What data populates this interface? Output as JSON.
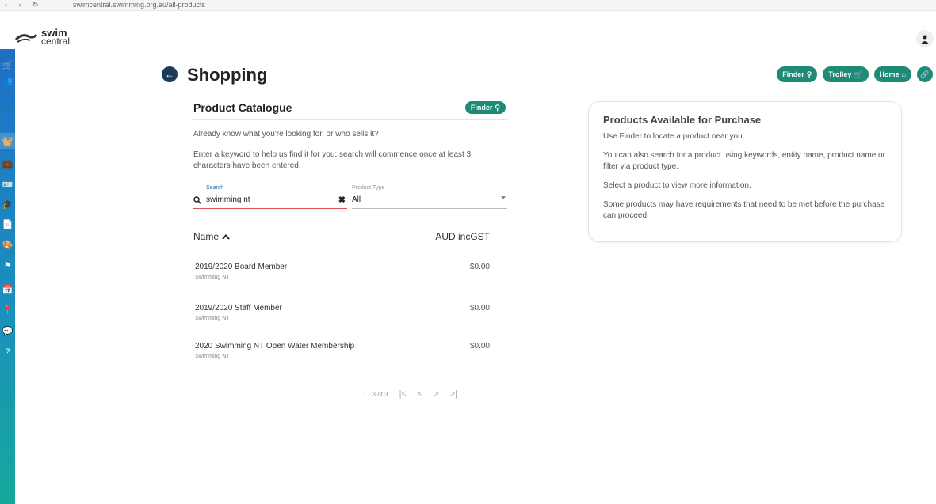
{
  "browser": {
    "nav_glyphs": "‹ › ↻",
    "url": "swimcentral.swimming.org.au/all-products"
  },
  "header": {
    "logo_line1": "swim",
    "logo_line2": "central",
    "profile_icon": "person-icon"
  },
  "sidebar": {
    "items": [
      {
        "icon": "cart-icon",
        "glyph": "🛒"
      },
      {
        "icon": "group-icon",
        "glyph": "👥"
      },
      {
        "icon": "add-person-icon",
        "glyph": "👤"
      },
      {
        "icon": "person-icon",
        "glyph": "👤"
      },
      {
        "icon": "basket-icon",
        "glyph": "🧺",
        "active": true
      },
      {
        "icon": "briefcase-icon",
        "glyph": "💼"
      },
      {
        "icon": "id-card-icon",
        "glyph": "🪪"
      },
      {
        "icon": "graduation-cap-icon",
        "glyph": "🎓"
      },
      {
        "icon": "document-icon",
        "glyph": "📄"
      },
      {
        "icon": "palette-icon",
        "glyph": "🎨"
      },
      {
        "icon": "flag-icon",
        "glyph": "⚑"
      },
      {
        "icon": "calendar-icon",
        "glyph": "📅"
      },
      {
        "icon": "map-pin-icon",
        "glyph": "📍"
      },
      {
        "icon": "chat-icon",
        "glyph": "💬"
      },
      {
        "icon": "help-icon",
        "glyph": "?"
      }
    ]
  },
  "page": {
    "back_glyph": "←",
    "title": "Shopping"
  },
  "actions": {
    "finder": "Finder",
    "trolley": "Trolley",
    "home": "Home",
    "finder_glyph": "⚲",
    "trolley_glyph": "🛒",
    "home_glyph": "⌂",
    "link_glyph": "🔗"
  },
  "catalogue": {
    "title": "Product Catalogue",
    "finder_label": "Finder",
    "finder_glyph": "⚲",
    "text1": "Already know what you're looking for, or who sells it?",
    "text2": "Enter a keyword to help us find it for you; search will commence once at least 3 characters have been entered.",
    "search": {
      "label": "Search",
      "value": "swimming nt",
      "search_glyph": "🔍",
      "clear_glyph": "✖"
    },
    "product_type": {
      "label": "Product Type",
      "value": "All"
    },
    "columns": {
      "name": "Name",
      "sort_glyph": "⌃",
      "price": "AUD incGST"
    },
    "rows": [
      {
        "name": "2019/2020 Board Member",
        "org": "Swimming NT",
        "price": "$0.00"
      },
      {
        "name": "2019/2020 Staff Member",
        "org": "Swimming NT",
        "price": "$0.00"
      },
      {
        "name": "2020 Swimming NT Open Water Membership",
        "org": "Swimming NT",
        "price": "$0.00"
      }
    ],
    "pager": {
      "range": "1 - 3 of 3",
      "first": "|<",
      "prev": "<",
      "next": ">",
      "last": ">|"
    }
  },
  "info": {
    "title": "Products Available for Purchase",
    "p1": "Use Finder to locate a product near you.",
    "p2": "You can also search for a product using keywords, entity name, product name or filter via product type.",
    "p3": "Select a product to view more information.",
    "p4": "Some products may have requirements that need to be met before the purchase can proceed."
  },
  "colors": {
    "accent_green": "#1d8b76",
    "back_button": "#1b3a57",
    "sidebar_top": "#1f6fc4",
    "sidebar_bottom": "#16a89a"
  }
}
